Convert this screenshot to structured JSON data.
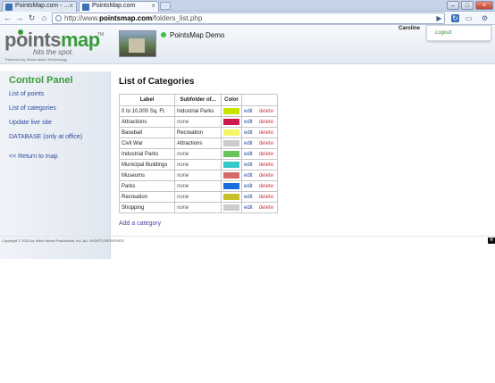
{
  "browser": {
    "tabs": [
      {
        "title": "PointsMap.com - ...",
        "active": false
      },
      {
        "title": "PointsMap.com",
        "active": true
      }
    ],
    "url_prefix": "http://www.",
    "url_domain": "pointsmap.com",
    "url_path": "/folders_list.php"
  },
  "header": {
    "logo_part1": "points",
    "logo_part2": "map",
    "logo_tm": "TM",
    "tagline": "hits the spot.",
    "powered_by": "Powered by Video Ideas Technology",
    "site_name": "PointsMap Demo",
    "username": "Caroline",
    "logout_label": "Logout"
  },
  "sidebar": {
    "title": "Control Panel",
    "links": [
      "List of points",
      "List of categories",
      "Update live site",
      "DATABASE (only at office)",
      "<< Return to map"
    ]
  },
  "main": {
    "title": "List of Categories",
    "columns": [
      "Label",
      "Subfolder of...",
      "Color"
    ],
    "edit_label": "edit",
    "delete_label": "delete",
    "rows": [
      {
        "label": "0 to 10,000 Sq. Ft.",
        "subfolder": "Industrial Parks",
        "color": "#c6e600"
      },
      {
        "label": "Attractions",
        "subfolder": "none",
        "color": "#cc1a4e"
      },
      {
        "label": "Baseball",
        "subfolder": "Recreation",
        "color": "#f5f56a"
      },
      {
        "label": "Civil War",
        "subfolder": "Attractions",
        "color": "#cccccc"
      },
      {
        "label": "Industrial Parks",
        "subfolder": "none",
        "color": "#6ac25a"
      },
      {
        "label": "Municipal Buildings",
        "subfolder": "none",
        "color": "#35c9c9"
      },
      {
        "label": "Museums",
        "subfolder": "none",
        "color": "#d46a6a"
      },
      {
        "label": "Parks",
        "subfolder": "none",
        "color": "#1a6ee0"
      },
      {
        "label": "Recreation",
        "subfolder": "none",
        "color": "#c9bf2a"
      },
      {
        "label": "Shopping",
        "subfolder": "none",
        "color": "#cccccc"
      }
    ],
    "add_link": "Add a category"
  },
  "footer": {
    "copyright": "Copyright © 2010 by Video Ideas Productions, Inc. ALL RIGHTS RESERVED",
    "vi_logo": "V"
  }
}
